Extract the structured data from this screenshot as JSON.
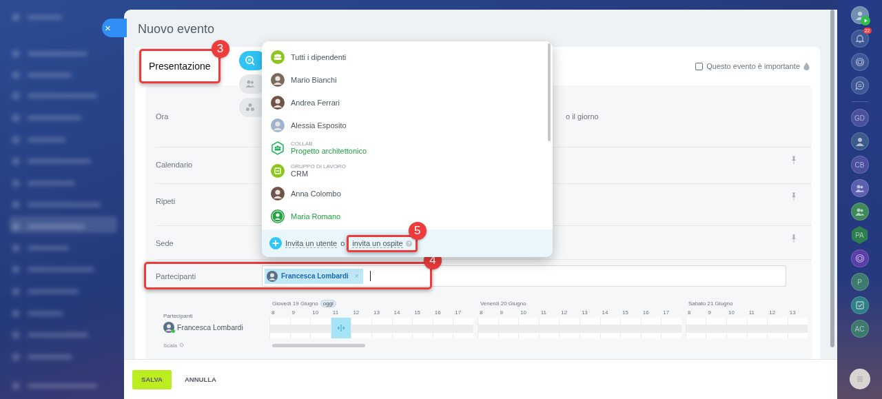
{
  "close_button": {
    "label": "×"
  },
  "panel": {
    "title": "Nuovo evento"
  },
  "event": {
    "name": "Presentazione",
    "callout": "3",
    "important": {
      "label": "Questo evento è importante",
      "checked": false
    }
  },
  "mode_tabs": [
    {
      "kind": "search",
      "selected": true
    },
    {
      "kind": "people",
      "selected": false
    },
    {
      "kind": "groups",
      "selected": false
    }
  ],
  "form_rows": [
    {
      "label": "Ora",
      "value": "o il giorno",
      "pin": false
    },
    {
      "label": "Calendario",
      "pin": true
    },
    {
      "label": "Ripeti",
      "pin": true
    },
    {
      "label": "Sede",
      "pin": true
    }
  ],
  "participants": {
    "label": "Partecipanti",
    "callout": "4",
    "chips": [
      {
        "name": "Francesca Lombardi",
        "remove": "×"
      }
    ]
  },
  "dropdown": {
    "items": [
      {
        "kind": "department",
        "name": "Tutti i dipendenti"
      },
      {
        "kind": "person",
        "name": "Mario Bianchi"
      },
      {
        "kind": "person",
        "name": "Andrea Ferrari"
      },
      {
        "kind": "person",
        "name": "Alessia Esposito"
      },
      {
        "kind": "collab",
        "caption": "COLLAB",
        "name": "Progetto architettonico"
      },
      {
        "kind": "workgroup",
        "caption": "GRUPPO DI LAVORO",
        "name": "CRM"
      },
      {
        "kind": "person",
        "name": "Anna Colombo"
      },
      {
        "kind": "extranet",
        "name": "Maria Romano"
      }
    ],
    "invite_user": "Invita un utente",
    "or": "o",
    "invite_guest": "invita un ospite",
    "callout": "5"
  },
  "planner": {
    "label": "Partecipanti",
    "scale": "Scala",
    "members": [
      {
        "name": "Francesca Lombardi",
        "online": true
      }
    ],
    "days": [
      {
        "label": "Giovedì 19 Giugno",
        "today": "oggi",
        "hours": [
          {
            "label": "8",
            "selected": false
          },
          {
            "label": "9",
            "selected": false
          },
          {
            "label": "10",
            "selected": false
          },
          {
            "label": "11",
            "selected": true
          },
          {
            "label": "12",
            "selected": false
          },
          {
            "label": "13",
            "selected": false
          },
          {
            "label": "14",
            "selected": false
          },
          {
            "label": "15",
            "selected": false
          },
          {
            "label": "16",
            "selected": false
          },
          {
            "label": "17",
            "selected": false
          }
        ]
      },
      {
        "label": "Venerdì 20 Giugno",
        "hours": [
          {
            "label": "8",
            "selected": false
          },
          {
            "label": "9",
            "selected": false
          },
          {
            "label": "10",
            "selected": false
          },
          {
            "label": "11",
            "selected": false
          },
          {
            "label": "12",
            "selected": false
          },
          {
            "label": "13",
            "selected": false
          },
          {
            "label": "14",
            "selected": false
          },
          {
            "label": "15",
            "selected": false
          },
          {
            "label": "16",
            "selected": false
          },
          {
            "label": "17",
            "selected": false
          }
        ]
      },
      {
        "label": "Sabato 21 Giugno",
        "hours": [
          {
            "label": "8",
            "selected": false
          },
          {
            "label": "9",
            "selected": false
          },
          {
            "label": "10",
            "selected": false
          },
          {
            "label": "11",
            "selected": false
          },
          {
            "label": "12",
            "selected": false
          },
          {
            "label": "13",
            "selected": false
          }
        ]
      }
    ]
  },
  "footer": {
    "save": "SALVA",
    "cancel": "ANNULLA"
  },
  "right_bar": {
    "items": [
      {
        "kind": "avatar",
        "color": "#6f8fb0"
      },
      {
        "kind": "bell",
        "badge": "22",
        "color": "#3e5796"
      },
      {
        "kind": "spiral",
        "color": "#3e5796"
      },
      {
        "kind": "chat",
        "color": "#3e5796"
      },
      {
        "kind": "divider"
      },
      {
        "kind": "initials",
        "text": "GD",
        "color": "#4a4f9e"
      },
      {
        "kind": "avatar",
        "color": "#3c5a8a"
      },
      {
        "kind": "initials",
        "text": "CB",
        "color": "#4a4f9e"
      },
      {
        "kind": "group",
        "color": "#5a5fb0"
      },
      {
        "kind": "group",
        "color": "#3f8a5a"
      },
      {
        "kind": "hex",
        "text": "PA",
        "color": "#2f7e4e"
      },
      {
        "kind": "spiral",
        "color": "#5a3fa8"
      },
      {
        "kind": "initials",
        "text": "P",
        "color": "#3e7a6e"
      },
      {
        "kind": "check",
        "color": "#2e7f86"
      },
      {
        "kind": "initials",
        "text": "AC",
        "color": "#3e7a6e"
      },
      {
        "kind": "menu",
        "color": "#d9d4d2"
      }
    ]
  }
}
